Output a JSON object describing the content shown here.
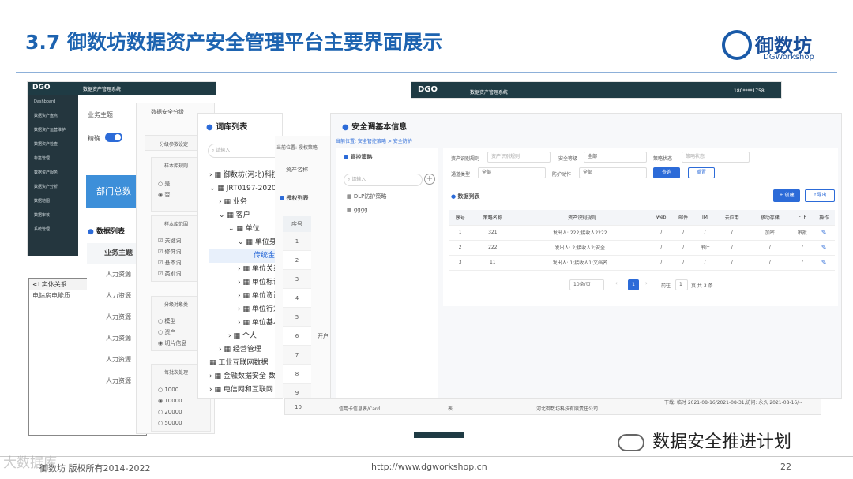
{
  "slide": {
    "title": "3.7 御数坊数据资产安全管理平台主要界面展示",
    "logo_brand": "御数坊",
    "logo_sub": "DGWorkshop",
    "footer_left": "御数坊 版权所有2014-2022",
    "footer_center": "http://www.dgworkshop.cn",
    "footer_page": "22",
    "wechat_text": "数据安全推进计划",
    "watermark": "大数据库"
  },
  "shot1": {
    "app_title": "数据资产管理系统",
    "user": "180****1758",
    "sidebar": [
      "Dashboard",
      "数据资产盘点",
      "数据资产运营维护",
      "数据资产检查",
      "标签管理",
      "数据资产服务",
      "数据资产分析",
      "数据地图",
      "数据审核",
      "系统管理"
    ],
    "business_subject": "业务主题",
    "precise_label": "精确",
    "banner": "部门总数",
    "data_list": "数据列表",
    "column": "业务主题",
    "rows": [
      "人力资源",
      "人力资源",
      "人力资源",
      "人力资源",
      "人力资源",
      "人力资源"
    ]
  },
  "shot2": {
    "title": "数据安全分级",
    "section1": "分级参数设定",
    "sample_src": "样本库规则",
    "opt_yes": "是",
    "opt_no": "否",
    "sample_scope": "样本库范围",
    "checks": [
      "关键词",
      "修饰词",
      "基本词",
      "类别词"
    ],
    "grade_object": "分级对象类",
    "objects": [
      "模型",
      "资产",
      "切片信息"
    ],
    "batch": "每批次处理",
    "batch_opts": [
      "1000",
      "10000",
      "20000",
      "50000"
    ]
  },
  "shot3": {
    "title": "词库列表",
    "search_placeholder": "请输入",
    "tree": [
      "御数坊(河北)科技",
      "JRT0197-2020金",
      "业务",
      "客户",
      "单位",
      "单位身份",
      "传统金融",
      "单位关系",
      "单位标识",
      "单位资讯",
      "单位行为",
      "单位基本",
      "个人",
      "经营管理",
      "工业互联网数据",
      "金融数据安全 数",
      "电信网和互联网"
    ]
  },
  "shot4": {
    "breadcrumb": "当前位置:  授权策略",
    "asset_name": "资产名称",
    "auth_list": "授权列表",
    "col_seq": "序号",
    "rows": [
      "1",
      "2",
      "3",
      "4",
      "5",
      "6",
      "7",
      "8",
      "9",
      "10"
    ],
    "row6_extra": "开户",
    "bottom_row": {
      "name": "信用卡信息表/Card",
      "type": "表",
      "company": "河北御数坊科技有限责任公司",
      "period": "下载: 临时 2021-08-16/2021-08-31,访问: 永久 2021-08-16/~"
    }
  },
  "shot5": {
    "title": "安全调基本信息",
    "breadcrumb": "当前位置:  安全管控策略  >  安全防护",
    "left_title": "管控策略",
    "search_placeholder": "请输入",
    "policies": [
      "DLP防护策略",
      "gggg"
    ],
    "f_asset_rule": "资产识别规则",
    "f_asset_rule_ph": "资产识别规则",
    "f_level": "安全等级",
    "f_level_val": "全部",
    "f_status": "策略状态",
    "f_status_ph": "策略状态",
    "f_channel": "通道类型",
    "f_channel_val": "全部",
    "f_action": "防护动作",
    "f_action_val": "全部",
    "btn_query": "查询",
    "btn_reset": "重置",
    "list_title": "数据列表",
    "btn_create": "+ 创建",
    "btn_export": "导出",
    "headers": [
      "序号",
      "策略名称",
      "资产识别规则",
      "web",
      "邮件",
      "IM",
      "云应用",
      "移动存储",
      "FTP",
      "操作"
    ],
    "rows": [
      [
        "1",
        "321",
        "发出人: 222;接收人2222...",
        "/",
        "/",
        "/",
        "/",
        "加密",
        "审批"
      ],
      [
        "2",
        "222",
        "发出人: 2;接收人2;安全...",
        "/",
        "/",
        "审计",
        "/",
        "/",
        "/"
      ],
      [
        "3",
        "11",
        "发出人: 1;接收人1;文档名...",
        "/",
        "/",
        "/",
        "/",
        "/",
        "/"
      ]
    ],
    "page_size": "10条/页",
    "page_current": "1",
    "goto_label": "前往",
    "goto_val": "1",
    "total": "页  共 3 条"
  },
  "shot6": {
    "app_title": "数据资产管理系统",
    "user": "180****1758"
  },
  "shot7": {
    "title": "实体关系",
    "sub": "电站房电能质"
  }
}
